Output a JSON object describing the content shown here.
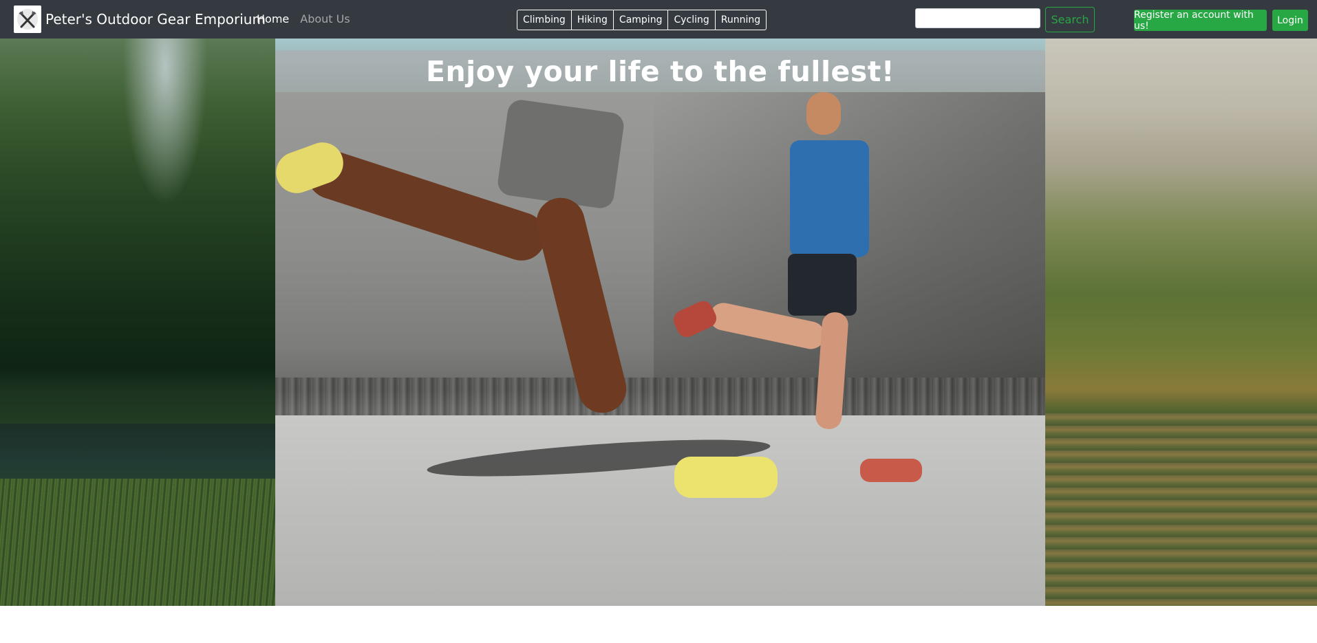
{
  "navbar": {
    "brand": "Peter's Outdoor Gear Emporium",
    "brand_icon": "crossed-ice-axes-logo",
    "links": [
      "Home",
      "About Us"
    ],
    "categories": [
      "Climbing",
      "Hiking",
      "Camping",
      "Cycling",
      "Running"
    ],
    "search": {
      "value": "",
      "placeholder": "",
      "button": "Search"
    },
    "register_button": "Register an account with us!",
    "login_button": "Login"
  },
  "hero": {
    "headline": "Enjoy your life to the fullest!"
  },
  "colors": {
    "navbar_bg": "#343a40",
    "success_green": "#28a745",
    "headline_bar": "#aaafb2"
  }
}
